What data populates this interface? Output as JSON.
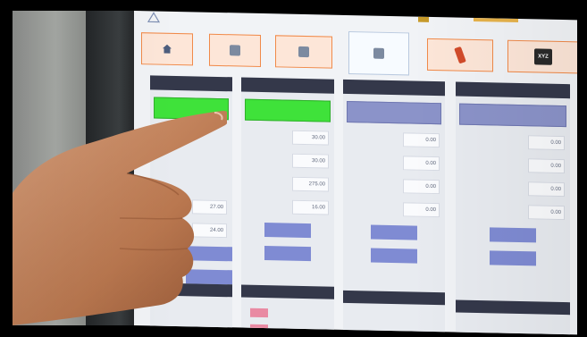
{
  "photo": {
    "subject": "hand pointing at a touchscreen HMI",
    "colors": {
      "frame": "#000000",
      "panel_bg": "#f1f3f6",
      "header": "#34384a",
      "tab_border": "#f08a4a",
      "status_on": "#3fe23a",
      "status_off": "#8b93c9",
      "button": "#7f8bd3"
    }
  },
  "screen": {
    "tabs": [
      {
        "icon": "home-icon"
      },
      {
        "icon": "machine-icon"
      },
      {
        "icon": "machine-icon"
      },
      {
        "icon": "machine-icon",
        "active": true
      },
      {
        "icon": "robot-arm-icon"
      },
      {
        "icon": "xyz-logo-icon",
        "badge": "XYZ"
      }
    ],
    "columns": [
      {
        "rows": [
          "27.00",
          "24.00"
        ]
      },
      {
        "rows": [
          "30.00",
          "30.00",
          "275.00",
          "16.00"
        ]
      },
      {
        "rows": [
          "0.00",
          "0.00",
          "0.00",
          "0.00"
        ]
      },
      {
        "rows": [
          "0.00",
          "0.00",
          "0.00",
          "0.00"
        ]
      }
    ]
  }
}
